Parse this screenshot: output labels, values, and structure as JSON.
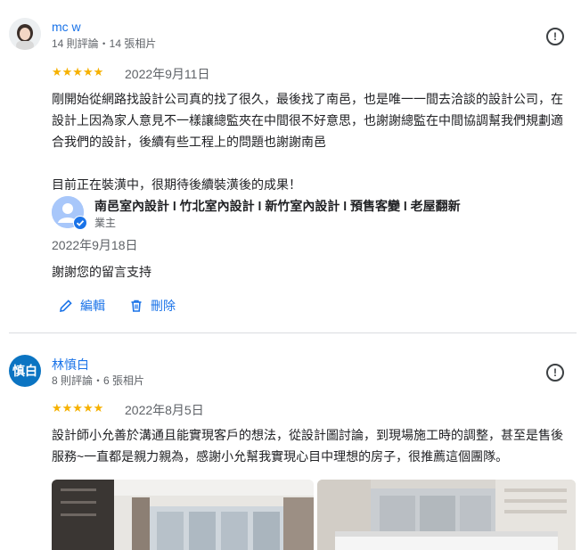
{
  "reviews": [
    {
      "name": "mc w",
      "meta": "14 則評論・14 張相片",
      "stars": "★★★★★",
      "date": "2022年9月11日",
      "text_lines": [
        "剛開始從網路找設計公司真的找了很久，最後找了南邑，也是唯一一間去洽談的設計公司，在",
        "設計上因為家人意見不一樣讓總監夾在中間很不好意思，也謝謝總監在中間協調幫我們規劃適",
        "合我們的設計，後續有些工程上的問題也謝謝南邑"
      ],
      "text_extra": "目前正在裝潢中，很期待後續裝潢後的成果！",
      "owner": {
        "name": "南邑室內設計 l 竹北室內設計 l 新竹室內設計 l 預售客變 l 老屋翻新",
        "role": "業主",
        "date": "2022年9月18日",
        "reply": "謝謝您的留言支持"
      },
      "actions": {
        "edit": "編輯",
        "delete": "刪除"
      }
    },
    {
      "name": "林慎白",
      "avatar_text": "慎白",
      "avatar_color": "#0b74c2",
      "meta": "8 則評論・6 張相片",
      "stars": "★★★★★",
      "date": "2022年8月5日",
      "text_lines": [
        "設計師小允善於溝通且能實現客戶的想法，從設計圖討論，到現場施工時的調整，甚至是售後",
        "服務~一直都是親力親為，感謝小允幫我實現心目中理想的房子，很推薦這個團隊。"
      ]
    }
  ],
  "colors": {
    "accent": "#1a73e8",
    "star": "#f6b100"
  }
}
